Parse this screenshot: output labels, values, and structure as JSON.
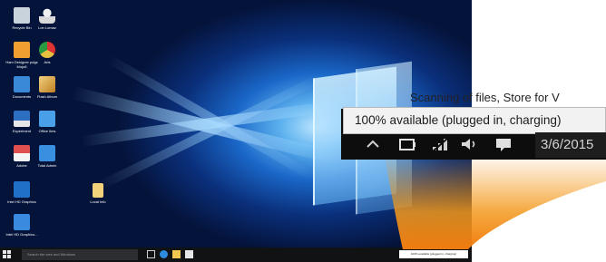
{
  "desktop_icons": [
    {
      "label": "Recycle Bin",
      "icon": "recycle-bin-icon",
      "color": "#c9d3dc"
    },
    {
      "label": "Lon Lomaz",
      "icon": "user-icon",
      "color": "#d9d9d9"
    },
    {
      "label": "Ham Designer pdgs Mojo8",
      "icon": "app-orange-icon",
      "color": "#f0a030"
    },
    {
      "label": "Arts",
      "icon": "chrome-icon",
      "color": "#e8c040"
    },
    {
      "label": "Documents",
      "icon": "documents-icon",
      "color": "#3a88d8"
    },
    {
      "label": "Flash Album",
      "icon": "flash-album-icon",
      "color": "#f0d080"
    },
    {
      "label": "Experiment",
      "icon": "experiment-icon",
      "color": "#2c6fc0"
    },
    {
      "label": "Office Ilms",
      "icon": "office-icon",
      "color": "#4aa0e8"
    },
    {
      "label": "Adobe",
      "icon": "adobe-icon",
      "color": "#e05050"
    },
    {
      "label": "Total Admin",
      "icon": "admin-icon",
      "color": "#3a90e0"
    },
    {
      "label": "Intel HD Graphics",
      "icon": "intel-icon",
      "color": "#2070c8"
    },
    {
      "label": "Intel HD Graphics...",
      "icon": "intel-graphics-icon",
      "color": "#3a8ae0"
    },
    {
      "label": "Local Info",
      "icon": "folder-icon",
      "color": "#f2d27a"
    }
  ],
  "taskbar": {
    "search_placeholder": "Search the web and Windows",
    "tray_popup_text": "100% available (plugged in, charging)",
    "icons": [
      "task-view-icon",
      "edge-icon",
      "file-explorer-icon",
      "store-icon"
    ]
  },
  "zoom": {
    "banner_text": "Scanning of files, Store for V",
    "tooltip_text": "100% available (plugged in, charging)",
    "tray_icons": [
      "chevron-up-icon",
      "battery-icon",
      "network-icon",
      "volume-icon",
      "action-center-icon"
    ],
    "date": "3/6/2015"
  },
  "colors": {
    "callout_orange": "#f39a1e",
    "taskbar_bg": "#101214",
    "tooltip_bg": "#f2f2f2"
  }
}
